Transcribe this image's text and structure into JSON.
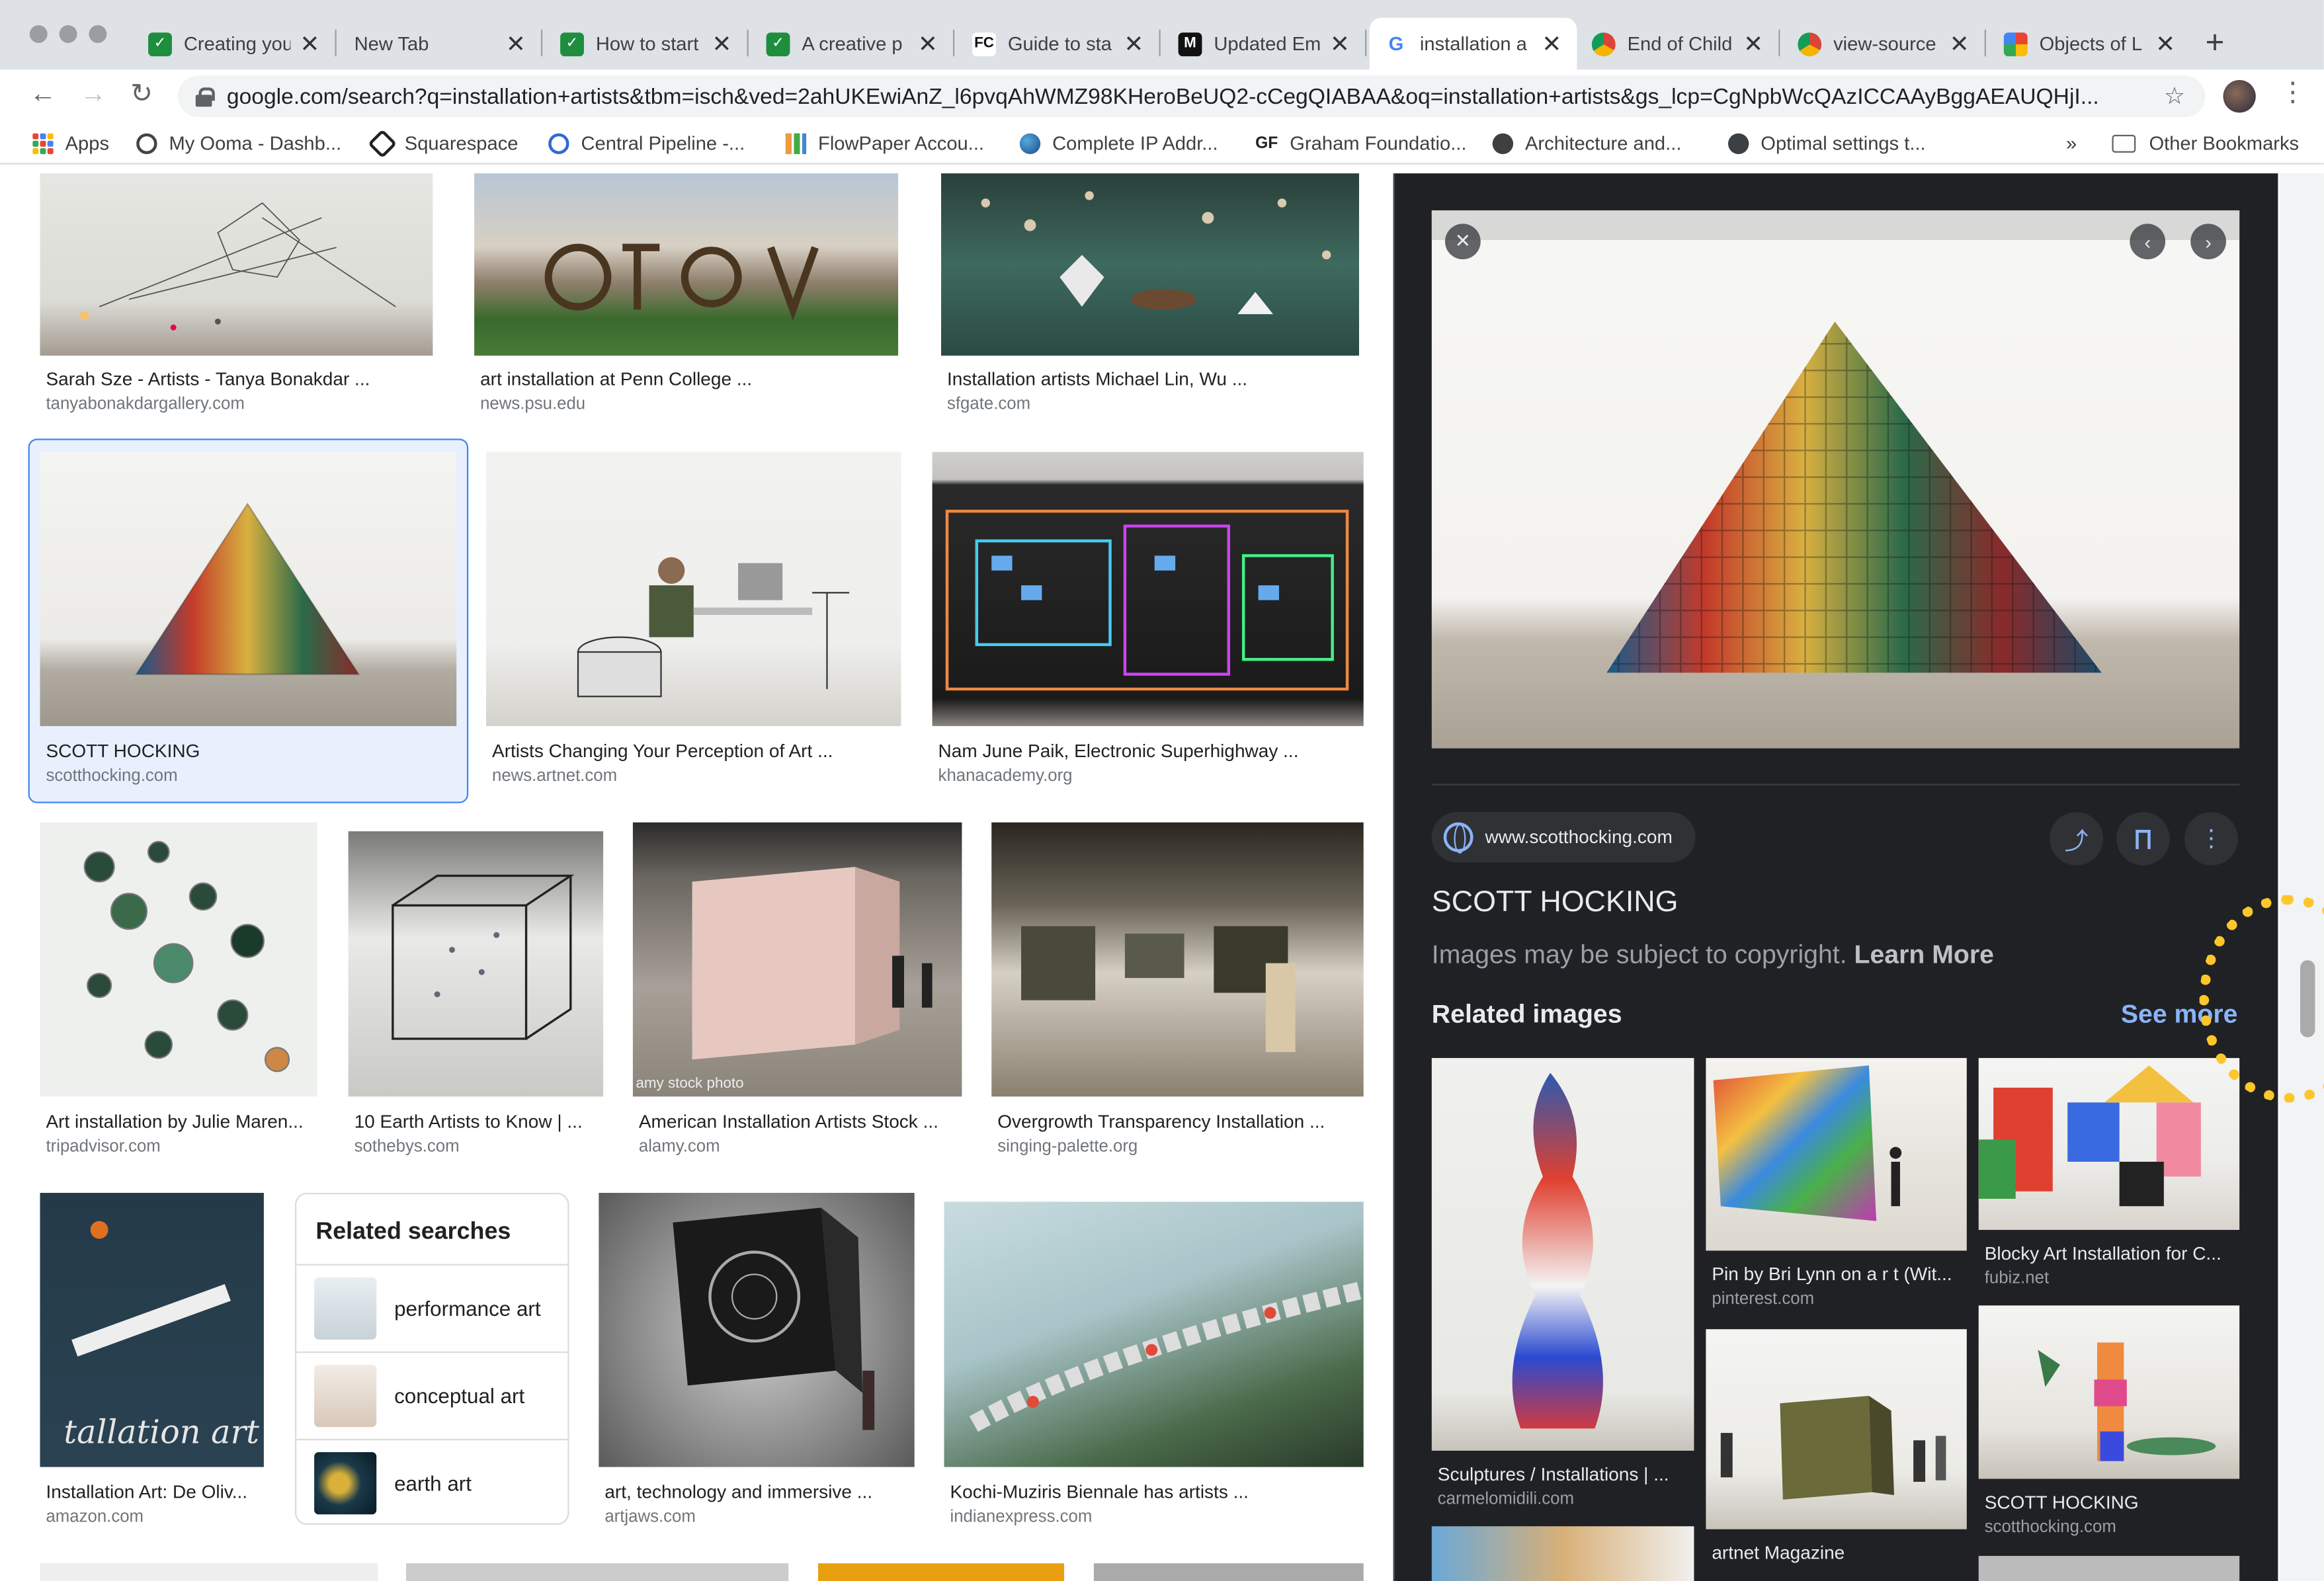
{
  "tabs": [
    {
      "title": "Creating your",
      "fav_color": "#1e8e3e",
      "fav_glyph": "✓"
    },
    {
      "title": "New Tab",
      "fav_color": "",
      "fav_glyph": ""
    },
    {
      "title": "How to start",
      "fav_color": "#1e8e3e",
      "fav_glyph": "✓"
    },
    {
      "title": "A creative p",
      "fav_color": "#1e8e3e",
      "fav_glyph": "✓"
    },
    {
      "title": "Guide to sta",
      "fav_color": "#111111",
      "fav_glyph": "FC"
    },
    {
      "title": "Updated Em",
      "fav_color": "#111111",
      "fav_glyph": "M"
    },
    {
      "title": "installation a",
      "fav_color": "#4285f4",
      "fav_glyph": "G"
    },
    {
      "title": "End of Child",
      "fav_color": "#e2574c",
      "fav_glyph": ""
    },
    {
      "title": "view-source",
      "fav_color": "#e2574c",
      "fav_glyph": ""
    },
    {
      "title": "Objects of L",
      "fav_color": "#f4b400",
      "fav_glyph": ""
    }
  ],
  "url": "google.com/search?q=installation+artists&tbm=isch&ved=2ahUKEwiAnZ_l6pvqAhWMZ98KHeroBeUQ2-cCegQIABAA&oq=installation+artists&gs_lcp=CgNpbWcQAzICCAAyBggAEAUQHjI...",
  "bookmarks": [
    {
      "label": "Apps",
      "icon": "apps-grid"
    },
    {
      "label": "My Ooma - Dashb...",
      "icon": "gear-icon"
    },
    {
      "label": "Squarespace",
      "icon": "squarespace-icon"
    },
    {
      "label": "Central Pipeline -...",
      "icon": "badge-icon"
    },
    {
      "label": "FlowPaper Accou...",
      "icon": "chart-icon"
    },
    {
      "label": "Complete IP Addr...",
      "icon": "globe-icon"
    },
    {
      "label": "Graham Foundatio...",
      "icon": "gf-icon"
    },
    {
      "label": "Architecture and...",
      "icon": "globe-icon"
    },
    {
      "label": "Optimal settings t...",
      "icon": "globe-icon"
    }
  ],
  "overflow": "»",
  "other_bookmarks": "Other Bookmarks",
  "results": [
    {
      "caption": "Sarah Sze - Artists - Tanya Bonakdar ...",
      "domain": "tanyabonakdargallery.com"
    },
    {
      "caption": "art installation at Penn College ...",
      "domain": "news.psu.edu"
    },
    {
      "caption": "Installation artists Michael Lin, Wu ...",
      "domain": "sfgate.com"
    },
    {
      "caption": "SCOTT HOCKING",
      "domain": "scotthocking.com"
    },
    {
      "caption": "Artists Changing Your Perception of Art ...",
      "domain": "news.artnet.com"
    },
    {
      "caption": "Nam June Paik, Electronic Superhighway ...",
      "domain": "khanacademy.org"
    },
    {
      "caption": "Art installation by Julie Maren...",
      "domain": "tripadvisor.com"
    },
    {
      "caption": "10 Earth Artists to Know | ...",
      "domain": "sothebys.com"
    },
    {
      "caption": "American Installation Artists Stock ...",
      "domain": "alamy.com"
    },
    {
      "caption": "Overgrowth Transparency Installation ...",
      "domain": "singing-palette.org"
    },
    {
      "caption": "Installation Art: De Oliv...",
      "domain": "amazon.com"
    },
    {
      "caption": "art, technology and immersive ...",
      "domain": "artjaws.com"
    },
    {
      "caption": "Kochi-Muziris Biennale has artists ...",
      "domain": "indianexpress.com"
    }
  ],
  "watermark": "amy stock photo",
  "book_text": "tallation art",
  "related_searches": {
    "title": "Related searches",
    "items": [
      "performance art",
      "conceptual art",
      "earth art"
    ]
  },
  "panel": {
    "site": "www.scotthocking.com",
    "title": "SCOTT HOCKING",
    "copyright": "Images may be subject to copyright.",
    "learn_more": "Learn More",
    "related_title": "Related images",
    "see_more": "See more",
    "related": [
      {
        "caption": "Sculptures / Installations | ...",
        "domain": "carmelomidili.com"
      },
      {
        "caption": "Pin by Bri Lynn on a r t (Wit...",
        "domain": "pinterest.com"
      },
      {
        "caption": "Blocky Art Installation for C...",
        "domain": "fubiz.net"
      },
      {
        "caption": "artnet Magazine",
        "domain": ""
      },
      {
        "caption": "SCOTT HOCKING",
        "domain": "scotthocking.com"
      }
    ]
  }
}
